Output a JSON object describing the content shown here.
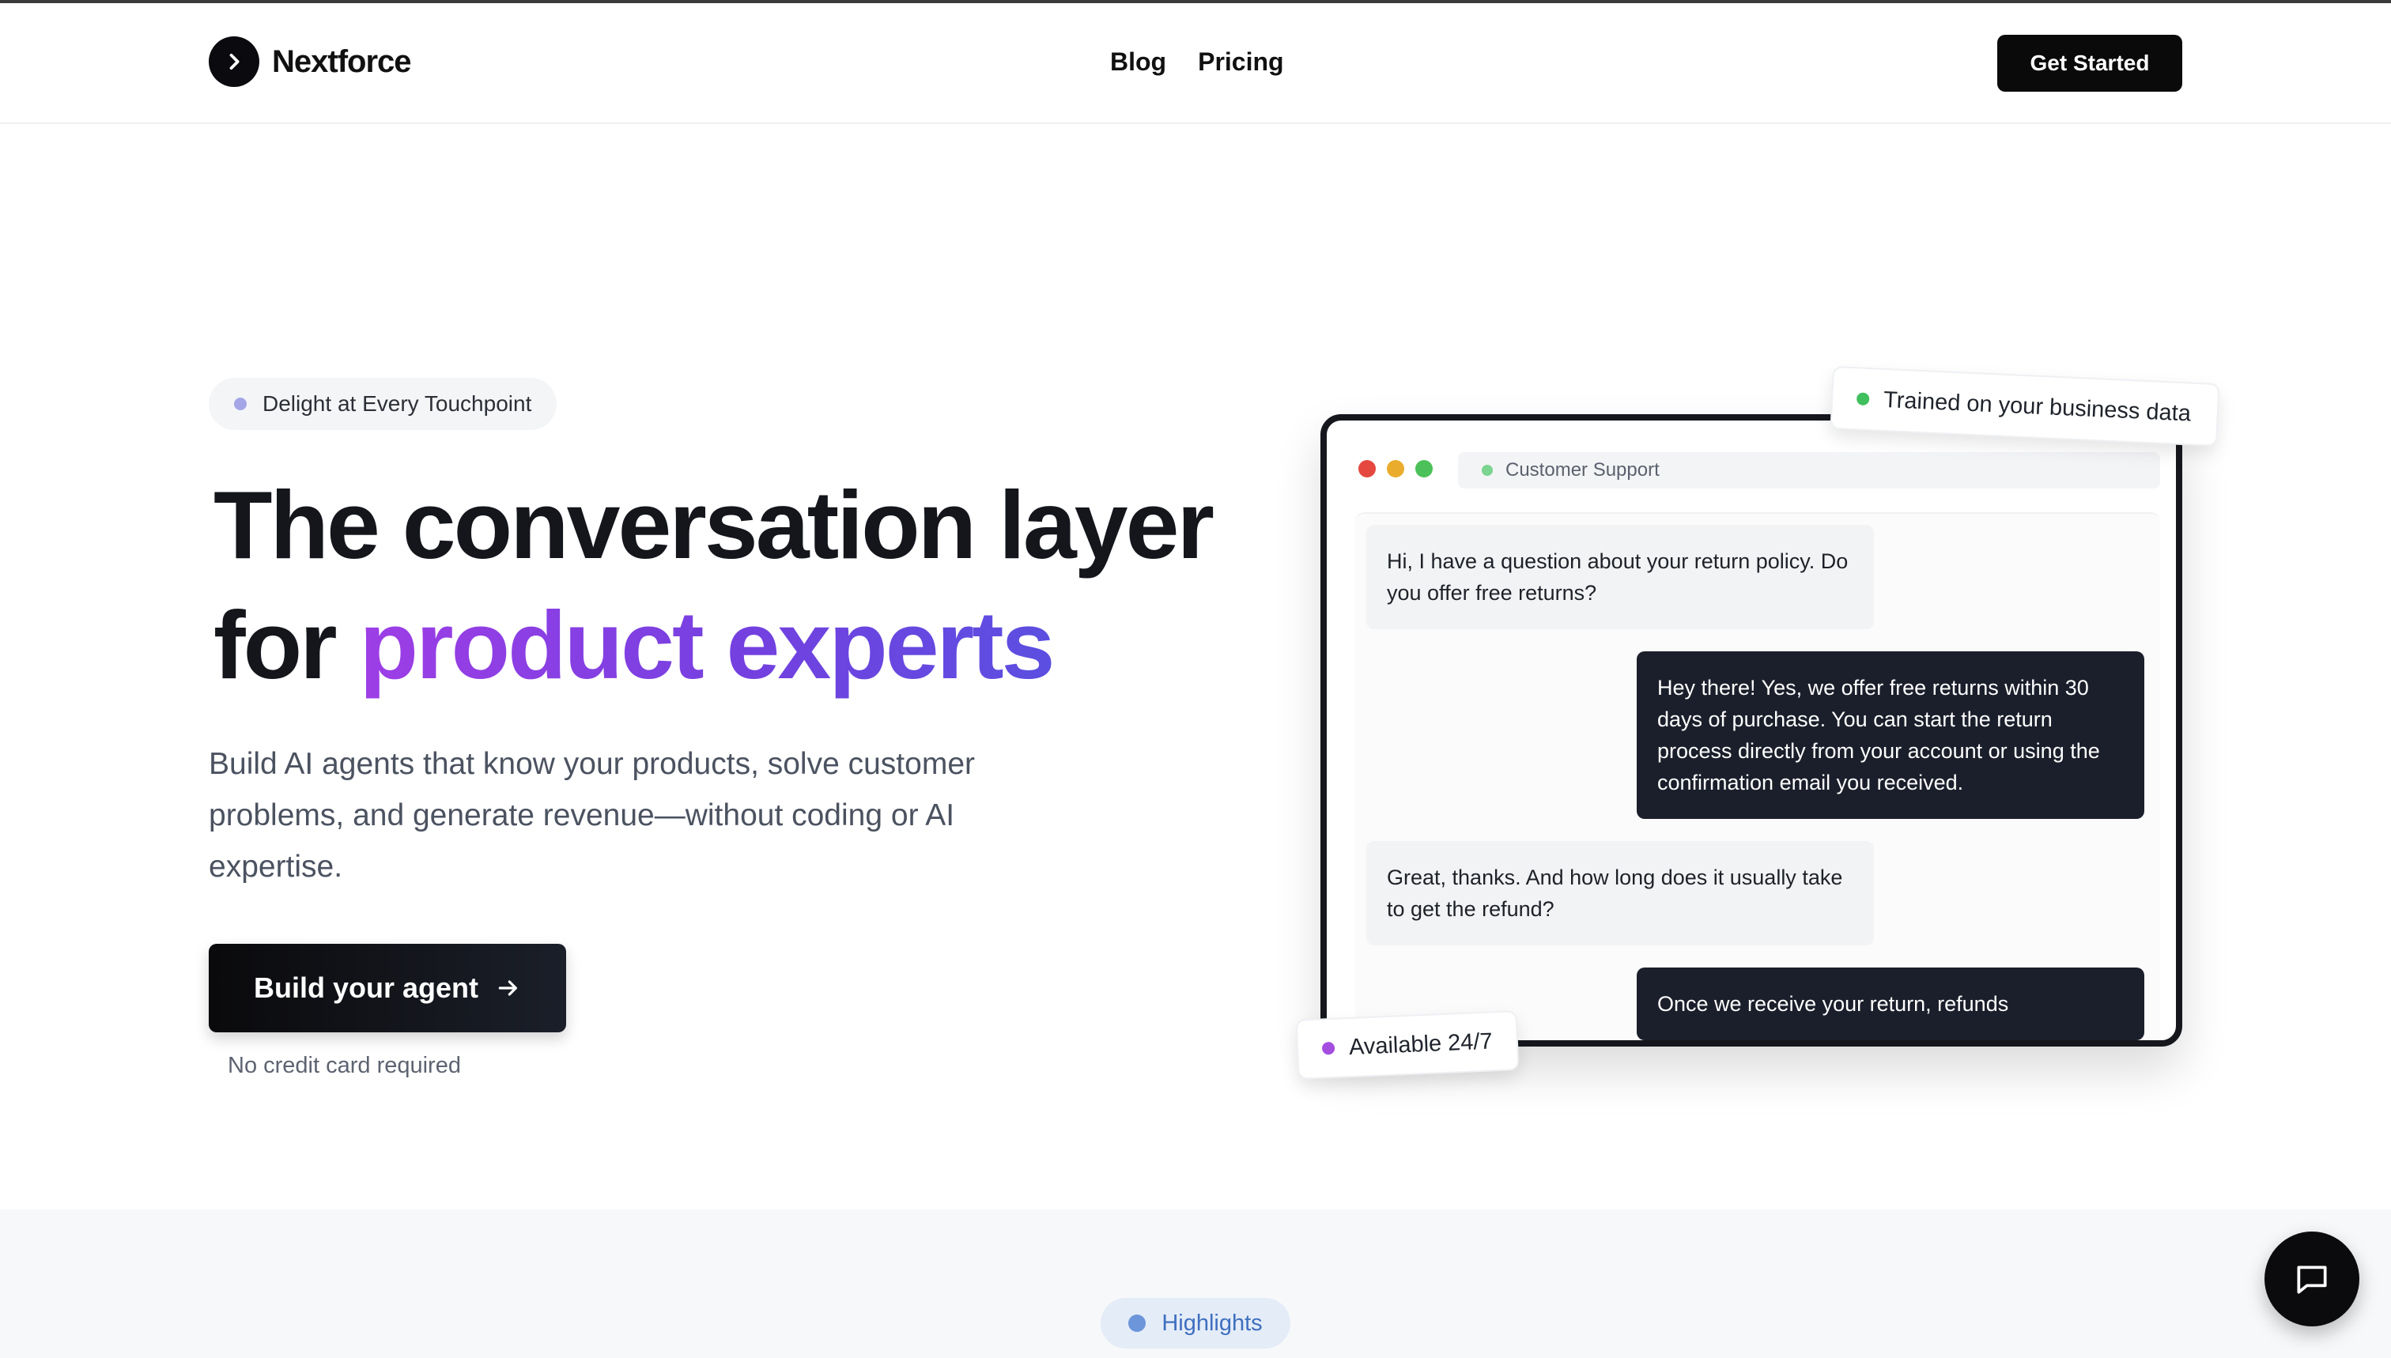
{
  "header": {
    "brand": "Nextforce",
    "nav": [
      {
        "label": "Blog"
      },
      {
        "label": "Pricing"
      }
    ],
    "cta_label": "Get Started"
  },
  "hero": {
    "pill_text": "Delight at Every Touchpoint",
    "title_line1": "The conversation layer",
    "title_for": "for",
    "title_highlight": "product experts",
    "subtitle": "Build AI agents that know your products, solve customer problems, and generate revenue—without coding or AI expertise.",
    "cta_label": "Build your agent",
    "note": "No credit card required"
  },
  "chat_window": {
    "title": "Customer Support",
    "messages": [
      {
        "role": "user",
        "text": "Hi, I have a question about your return policy. Do you offer free returns?"
      },
      {
        "role": "bot",
        "text": "Hey there! Yes, we offer free returns within 30 days of purchase. You can start the return process directly from your account or using the confirmation email you received."
      },
      {
        "role": "user",
        "text": "Great, thanks. And how long does it usually take to get the refund?"
      },
      {
        "role": "bot",
        "text": "Once we receive your return, refunds"
      }
    ],
    "badge_trained": "Trained on your business data",
    "badge_available": "Available 24/7"
  },
  "highlights": {
    "label": "Highlights"
  },
  "colors": {
    "accent_purple": "#9e3ee6",
    "accent_indigo": "#5b4fe0",
    "dark": "#0a0a0c",
    "dot_red": "#e5483f",
    "dot_yellow": "#e9ac2c",
    "dot_green": "#4cc15a",
    "badge_green": "#3fbf5d",
    "badge_purple": "#a44ee0"
  },
  "icons": {
    "logo": "chevron-right-icon",
    "build_arrow": "arrow-right-icon",
    "chat_fab": "chat-bubble-icon"
  }
}
